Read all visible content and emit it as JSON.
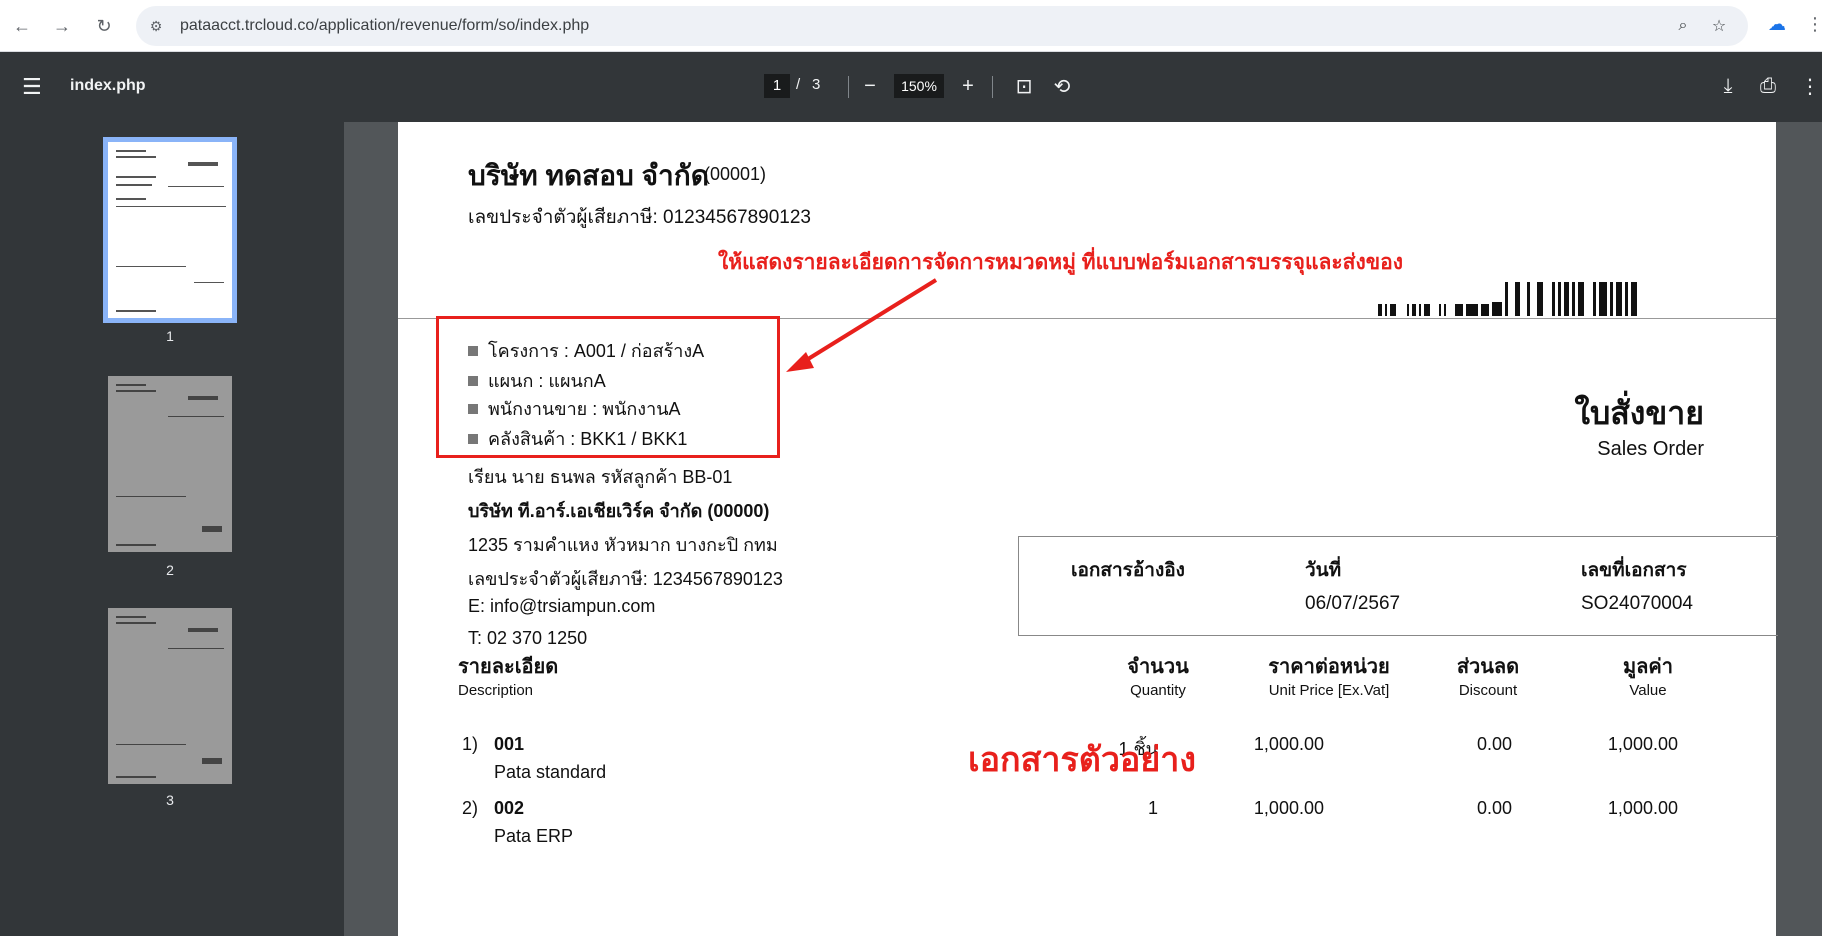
{
  "browser": {
    "url": "pataacct.trcloud.co/application/revenue/form/so/index.php",
    "back_icon": "arrow-left-icon",
    "forward_icon": "arrow-right-icon",
    "reload_icon": "reload-icon"
  },
  "pdf_toolbar": {
    "file_name": "index.php",
    "current_page": "1",
    "page_separator": "/",
    "total_pages": "3",
    "zoom": "150%"
  },
  "thumbnails": [
    {
      "label": "1"
    },
    {
      "label": "2"
    },
    {
      "label": "3"
    }
  ],
  "document": {
    "company_name": "บริษัท ทดสอบ จำกัด",
    "company_code": "(00001)",
    "tax_id": "เลขประจำตัวผู้เสียภาษี: 01234567890123",
    "info_lines": [
      "โครงการ : A001 / ก่อสร้างA",
      "แผนก : แผนกA",
      "พนักงานขาย : พนักงานA",
      "คลังสินค้า : BKK1 / BKK1"
    ],
    "customer": {
      "attn": "เรียน นาย ธนพล รหัสลูกค้า BB-01",
      "company": "บริษัท ที.อาร์.เอเชียเวิร์ค จำกัด (00000)",
      "address": "1235 รามคำแหง หัวหมาก บางกะปิ กทม",
      "tax_id": "เลขประจำตัวผู้เสียภาษี: 1234567890123",
      "email": "E: info@trsiampun.com",
      "phone": "T: 02 370 1250"
    },
    "title_th": "ใบสั่งขาย",
    "title_en": "Sales Order",
    "reference": {
      "ref_label": "เอกสารอ้างอิง",
      "date_label": "วันที่",
      "date_value": "06/07/2567",
      "docno_label": "เลขที่เอกสาร",
      "docno_value": "SO24070004"
    },
    "columns": {
      "desc_th": "รายละเอียด",
      "desc_en": "Description",
      "qty_th": "จำนวน",
      "qty_en": "Quantity",
      "price_th": "ราคาต่อหน่วย",
      "price_en": "Unit Price [Ex.Vat]",
      "disc_th": "ส่วนลด",
      "disc_en": "Discount",
      "value_th": "มูลค่า",
      "value_en": "Value"
    },
    "items": [
      {
        "no": "1)",
        "code": "001",
        "name": "Pata standard",
        "qty": "1 ชิ้น",
        "price": "1,000.00",
        "discount": "0.00",
        "value": "1,000.00"
      },
      {
        "no": "2)",
        "code": "002",
        "name": "Pata ERP",
        "qty": "1",
        "price": "1,000.00",
        "discount": "0.00",
        "value": "1,000.00"
      }
    ]
  },
  "annotation": {
    "text": "ให้แสดงรายละเอียดการจัดการหมวดหมู่ ที่แบบฟอร์มเอกสารบรรจุและส่งของ",
    "watermark": "เอกสารตัวอย่าง",
    "color": "#e8201c"
  }
}
